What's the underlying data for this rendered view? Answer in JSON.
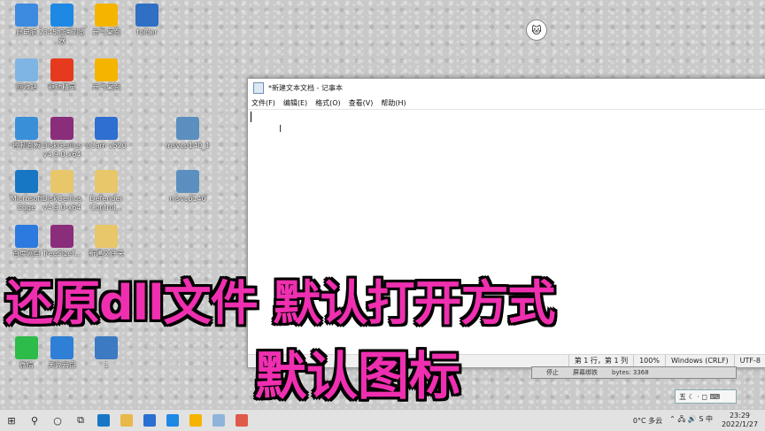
{
  "desktop_icons": [
    {
      "label": "此电脑",
      "icon": "computer-icon",
      "color": "#3c8be0"
    },
    {
      "label": "2345加速浏览器",
      "icon": "ie-browser-icon",
      "color": "#1e88e5"
    },
    {
      "label": "元气桌面",
      "icon": "yuanqi-icon",
      "color": "#f5b400"
    },
    {
      "label": "folder",
      "icon": "folder-app-icon",
      "color": "#2f6fc4"
    },
    {
      "label": "回收站",
      "icon": "recycle-bin-icon",
      "color": "#7fb5e5"
    },
    {
      "label": "驱动精灵",
      "icon": "driver-genius-icon",
      "color": "#e53a1e"
    },
    {
      "label": "元气桌面",
      "icon": "yuanqi-icon",
      "color": "#f5b400"
    },
    {
      "label": "控制面板",
      "icon": "control-panel-icon",
      "color": "#3a8fd9"
    },
    {
      "label": "DiskGenius\nv4.9.0-x64",
      "icon": "winrar-icon",
      "color": "#8a2d7a"
    },
    {
      "label": "oCam v520",
      "icon": "ocam-icon",
      "color": "#2e6fd1"
    },
    {
      "label": "msvcp140_1",
      "icon": "dll-file-icon",
      "color": "#5b8fbf"
    },
    {
      "label": "Microsoft\nEdge",
      "icon": "edge-icon",
      "color": "#1777c4"
    },
    {
      "label": "DiskGenius\nv4.9.0-x64",
      "icon": "folder-icon",
      "color": "#e8c66a"
    },
    {
      "label": "Defender\nControl...",
      "icon": "folder-icon",
      "color": "#e8c66a"
    },
    {
      "label": "msvcp140",
      "icon": "dll-file-icon",
      "color": "#5b8fbf"
    },
    {
      "label": "百度网盘",
      "icon": "cloud-icon",
      "color": "#2c7ae0"
    },
    {
      "label": "TreeSizeF...",
      "icon": "winrar-icon",
      "color": "#8a2d7a"
    },
    {
      "label": "新建文件夹",
      "icon": "folder-icon",
      "color": "#e8c66a"
    },
    {
      "label": "微信",
      "icon": "wechat-icon",
      "color": "#2dbb4a"
    },
    {
      "label": "天翼云盘",
      "icon": "tianyi-icon",
      "color": "#2f7fd6"
    },
    {
      "label": "1",
      "icon": "setup-icon",
      "color": "#3c7ac4"
    }
  ],
  "notepad": {
    "title": "*新建文本文档 - 记事本",
    "menu": [
      "文件(F)",
      "编辑(E)",
      "格式(O)",
      "查看(V)",
      "帮助(H)"
    ],
    "cursor_glyph": "I",
    "status": [
      "第 1 行，第 1 列",
      "100%",
      "Windows (CRLF)",
      "UTF-8"
    ]
  },
  "background_window_status": [
    "停止",
    "屏幕绑铁",
    "bytes: 3368"
  ],
  "captions": {
    "line1": "还原dll文件 默认打开方式",
    "line2": "默认图标"
  },
  "ime_toolbar": {
    "label": "五 ☾ · ◻ ⌨"
  },
  "taskbar": {
    "start": "⊞",
    "search": "⚲",
    "cortana": "○",
    "taskview": "⧉",
    "apps": [
      {
        "icon": "edge-icon",
        "color": "#1777c4"
      },
      {
        "icon": "file-explorer-icon",
        "color": "#e8b84a"
      },
      {
        "icon": "mail-icon",
        "color": "#2a6fd1"
      },
      {
        "icon": "ie-browser-icon",
        "color": "#1e88e5"
      },
      {
        "icon": "yuanqi-icon",
        "color": "#f5b400"
      },
      {
        "icon": "notepad-icon",
        "color": "#8fb4d9"
      },
      {
        "icon": "screen-recorder-icon",
        "color": "#e05a4a"
      }
    ],
    "weather": "0°C  多云",
    "tray_icons": "⌃ 🖧 🔊 S 中",
    "time": "23:29",
    "date": "2022/1/27"
  }
}
